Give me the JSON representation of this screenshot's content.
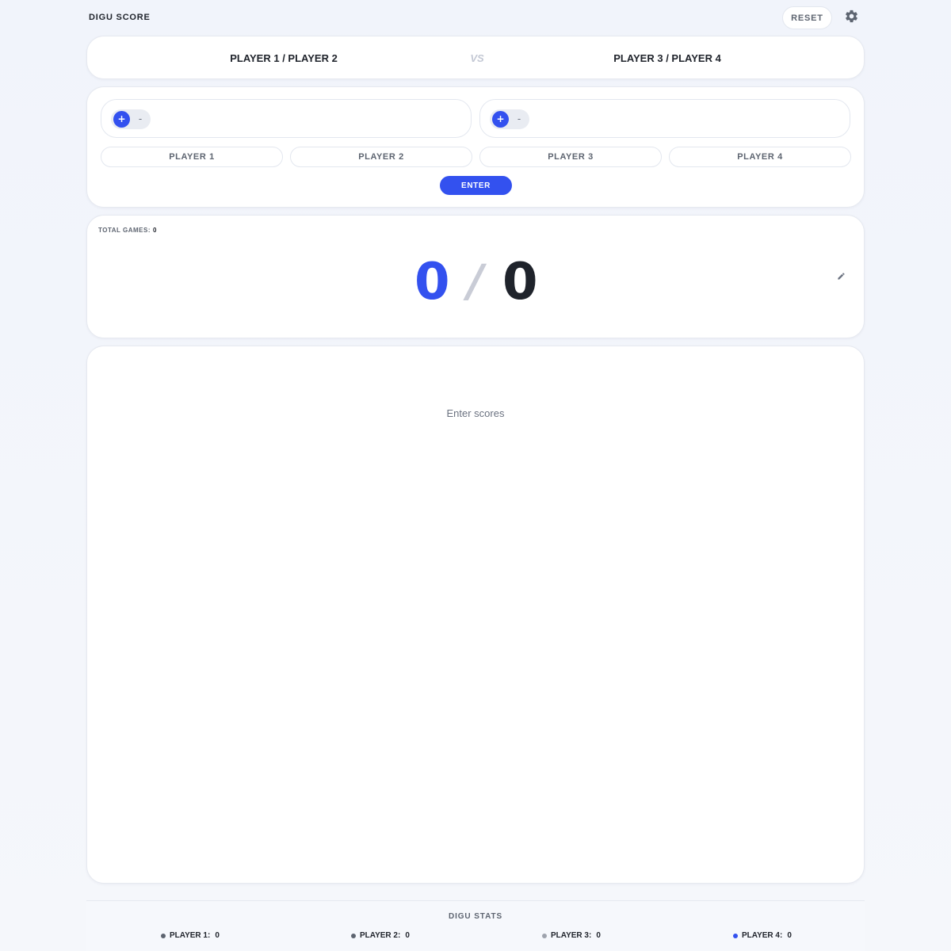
{
  "app": {
    "title": "DIGU SCORE",
    "reset_label": "RESET",
    "settings_icon": "gear-icon"
  },
  "match": {
    "team_a": "PLAYER 1 / PLAYER 2",
    "vs": "VS",
    "team_b": "PLAYER 3 / PLAYER 4"
  },
  "entry": {
    "team_a_stepper": {
      "plus": "+",
      "minus": "-"
    },
    "team_b_stepper": {
      "plus": "+",
      "minus": "-"
    },
    "players": [
      "PLAYER 1",
      "PLAYER 2",
      "PLAYER 3",
      "PLAYER 4"
    ],
    "enter_label": "ENTER"
  },
  "scoreboard": {
    "total_games_label": "TOTAL GAMES:",
    "total_games": "0",
    "score_a": "0",
    "separator": "/",
    "score_b": "0"
  },
  "history": {
    "empty_message": "Enter scores"
  },
  "stats": {
    "title": "DIGU STATS",
    "players": [
      {
        "name": "PLAYER 1:",
        "value": "0",
        "color": "#5d6470"
      },
      {
        "name": "PLAYER 2:",
        "value": "0",
        "color": "#5d6470"
      },
      {
        "name": "PLAYER 3:",
        "value": "0",
        "color": "#9ea3ad"
      },
      {
        "name": "PLAYER 4:",
        "value": "0",
        "color": "#3351ef"
      }
    ]
  },
  "colors": {
    "accent": "#3351ef",
    "text": "#1f232b",
    "muted": "#5d6470"
  }
}
